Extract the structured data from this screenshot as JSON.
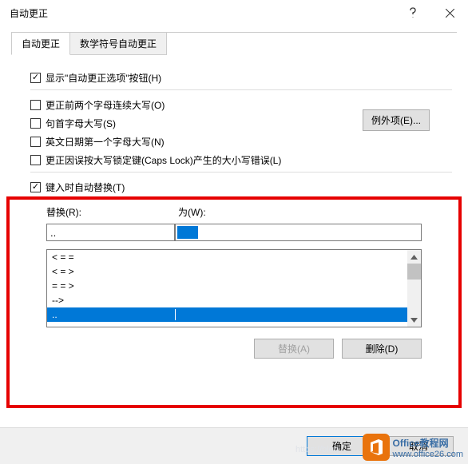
{
  "window": {
    "title": "自动更正"
  },
  "tabs": {
    "t1": "自动更正",
    "t2": "数学符号自动更正"
  },
  "options": {
    "show_btn": "显示\"自动更正选项\"按钮(H)",
    "two_caps": "更正前两个字母连续大写(O)",
    "sentence": "句首字母大写(S)",
    "eng_date": "英文日期第一个字母大写(N)",
    "capslock": "更正因误按大写锁定键(Caps Lock)产生的大小写错误(L)",
    "replace_on_type": "键入时自动替换(T)",
    "exceptions": "例外项(E)..."
  },
  "replace": {
    "label_r": "替换(R):",
    "label_w": "为(W):",
    "value_r": "..",
    "list": [
      {
        "from": "< = =",
        "to": ""
      },
      {
        "from": "< = >",
        "to": ""
      },
      {
        "from": "= = >",
        "to": ""
      },
      {
        "from": "-->",
        "to": ""
      },
      {
        "from": "..",
        "to": ""
      }
    ]
  },
  "buttons": {
    "replace": "替换(A)",
    "delete": "删除(D)",
    "ok": "确定",
    "cancel": "取消"
  },
  "watermark": {
    "line1a": "Office",
    "line1b": "教程网",
    "url": "www.office26.com"
  }
}
